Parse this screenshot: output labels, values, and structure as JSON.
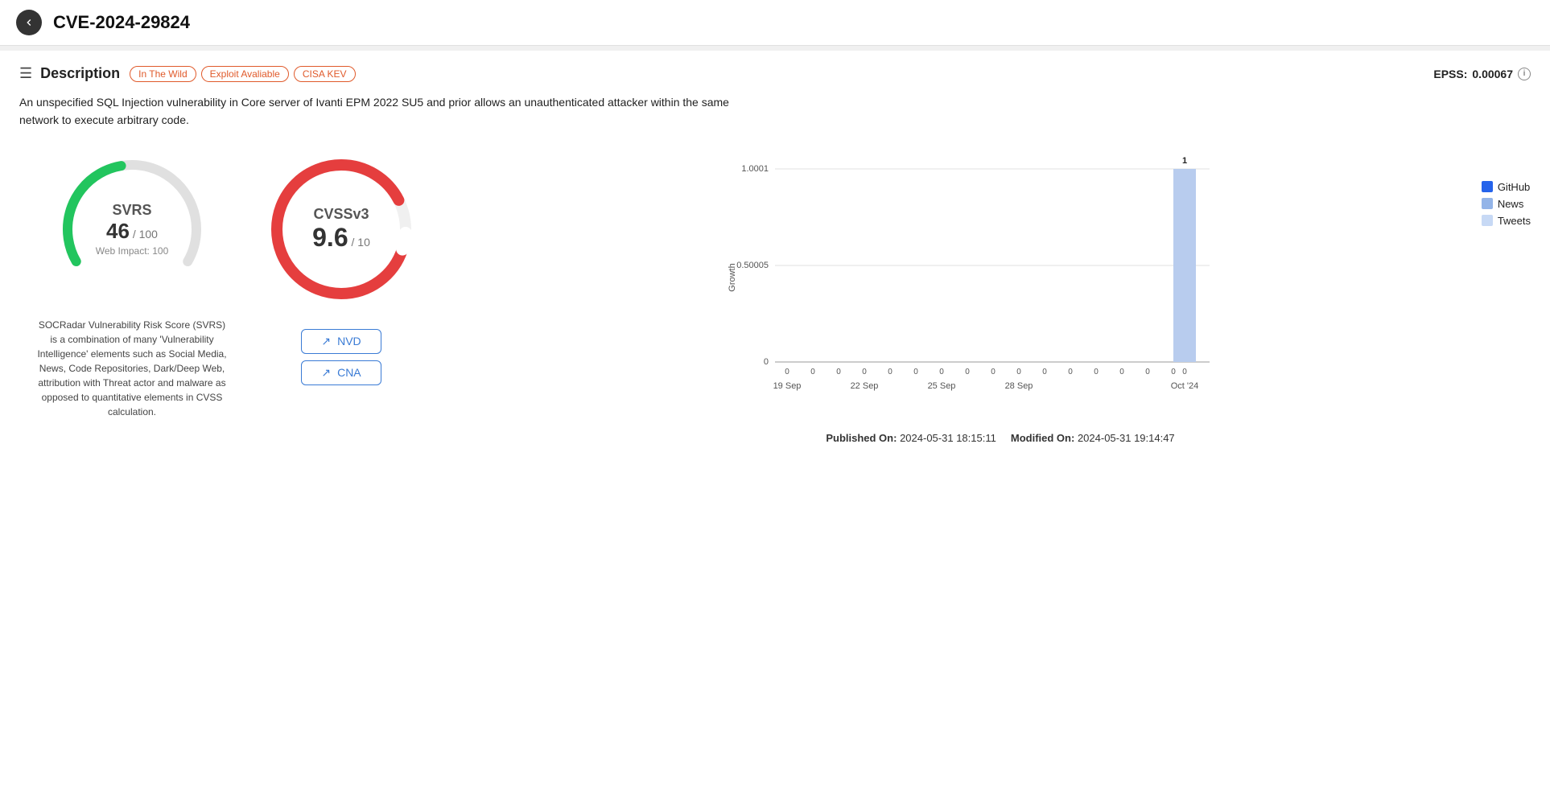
{
  "header": {
    "back_label": "back",
    "cve_id": "CVE-2024-29824"
  },
  "section": {
    "title": "Description",
    "badges": [
      "In The Wild",
      "Exploit Avaliable",
      "CISA KEV"
    ],
    "epss_label": "EPSS:",
    "epss_value": "0.00067"
  },
  "description": "An unspecified SQL Injection vulnerability in Core server of Ivanti EPM 2022 SU5 and prior allows an unauthenticated attacker within the same network to execute arbitrary code.",
  "svrs": {
    "label": "SVRS",
    "score": "46",
    "denom": "/ 100",
    "web_impact": "Web Impact: 100",
    "description": "SOCRadar Vulnerability Risk Score (SVRS) is a combination of many 'Vulnerability Intelligence' elements such as Social Media, News, Code Repositories, Dark/Deep Web, attribution with Threat actor and malware as opposed to quantitative elements in CVSS calculation."
  },
  "cvss": {
    "label": "CVSSv3",
    "score": "9.6",
    "denom": "/ 10",
    "btn_nvd": "NVD",
    "btn_cna": "CNA"
  },
  "chart": {
    "y_labels": [
      "1.0001",
      "0.50005",
      "0"
    ],
    "x_labels": [
      "19 Sep",
      "22 Sep",
      "25 Sep",
      "28 Sep",
      "Oct '24"
    ],
    "bar_value_label": "1",
    "zero_label": "0",
    "y_axis_label": "Growth",
    "legend": [
      {
        "label": "GitHub",
        "color": "#2563eb"
      },
      {
        "label": "News",
        "color": "#93b4e8"
      },
      {
        "label": "Tweets",
        "color": "#c7d9f5"
      }
    ]
  },
  "footer": {
    "published_label": "Published On:",
    "published_value": "2024-05-31 18:15:11",
    "modified_label": "Modified On:",
    "modified_value": "2024-05-31 19:14:47"
  }
}
